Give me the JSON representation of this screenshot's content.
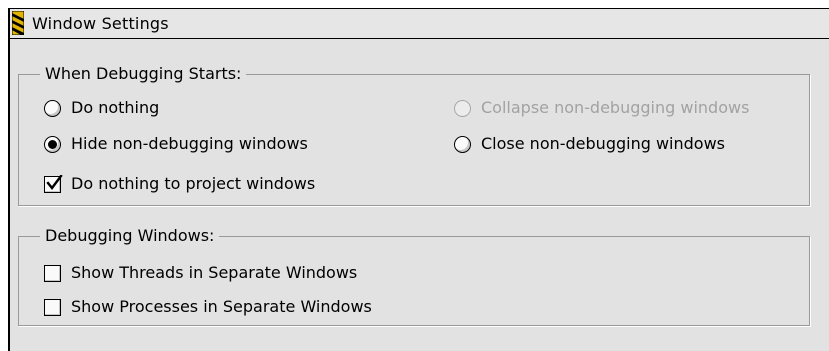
{
  "window": {
    "title": "Window Settings"
  },
  "debug_start": {
    "legend": "When Debugging Starts:",
    "options": [
      {
        "label": "Do nothing",
        "selected": false,
        "enabled": true
      },
      {
        "label": "Hide non-debugging windows",
        "selected": true,
        "enabled": true
      },
      {
        "label": "Collapse non-debugging windows",
        "selected": false,
        "enabled": false
      },
      {
        "label": "Close non-debugging windows",
        "selected": false,
        "enabled": true
      }
    ],
    "project_checkbox": {
      "label": "Do nothing to project windows",
      "checked": true
    }
  },
  "debug_windows": {
    "legend": "Debugging Windows:",
    "checkboxes": [
      {
        "label": "Show Threads in Separate Windows",
        "checked": false
      },
      {
        "label": "Show Processes in Separate Windows",
        "checked": false
      }
    ]
  },
  "icons": [
    "title-stripe-icon",
    "checkmark-icon"
  ]
}
